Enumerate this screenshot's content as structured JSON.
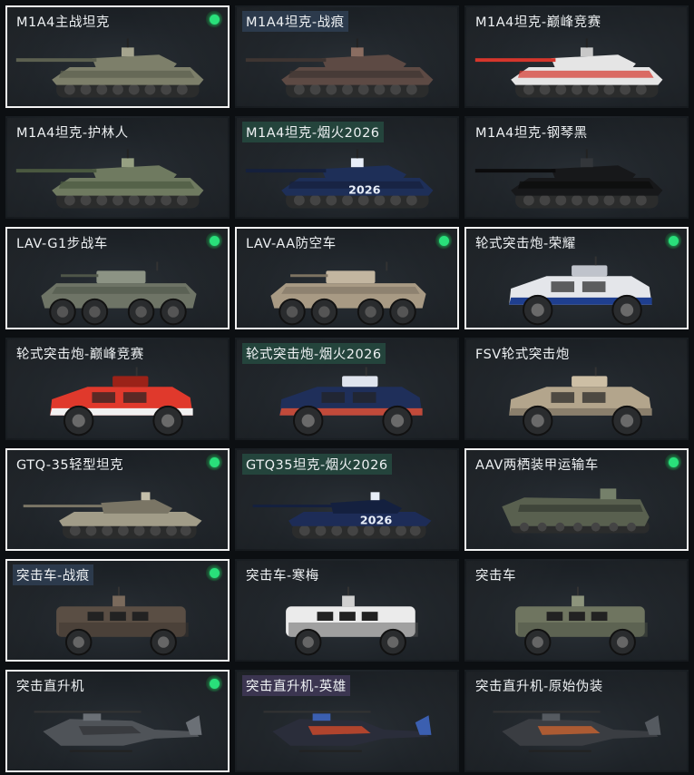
{
  "vehicles": [
    {
      "name": "M1A4主战坦克",
      "kind": "tank",
      "selected": true,
      "owned": true,
      "tag": "",
      "colors": {
        "body": "#7d7f6a",
        "accent": "#5c6050",
        "detail": "#a5a48e"
      }
    },
    {
      "name": "M1A4坦克-战痕",
      "kind": "tank",
      "selected": false,
      "owned": false,
      "tag": "blue",
      "colors": {
        "body": "#5d4a44",
        "accent": "#3e3532",
        "detail": "#8a6d61"
      }
    },
    {
      "name": "M1A4坦克-巅峰竞赛",
      "kind": "tank",
      "selected": false,
      "owned": false,
      "tag": "",
      "colors": {
        "body": "#e5e5e5",
        "accent": "#d6362c",
        "detail": "#c8c8c8"
      }
    },
    {
      "name": "M1A4坦克-护林人",
      "kind": "tank",
      "selected": false,
      "owned": false,
      "tag": "",
      "colors": {
        "body": "#6f7a60",
        "accent": "#4a5840",
        "detail": "#96a082"
      }
    },
    {
      "name": "M1A4坦克-烟火2026",
      "kind": "tank",
      "selected": false,
      "owned": false,
      "tag": "green",
      "colors": {
        "body": "#1e2f58",
        "accent": "#15203c",
        "detail": "#e8eef8"
      },
      "decal": "2026"
    },
    {
      "name": "M1A4坦克-钢琴黑",
      "kind": "tank",
      "selected": false,
      "owned": false,
      "tag": "",
      "colors": {
        "body": "#17181a",
        "accent": "#0b0b0c",
        "detail": "#33363a"
      }
    },
    {
      "name": "LAV-G1步战车",
      "kind": "ifv",
      "selected": true,
      "owned": true,
      "tag": "",
      "colors": {
        "body": "#6e7466",
        "accent": "#4f5649",
        "detail": "#8c9384"
      }
    },
    {
      "name": "LAV-AA防空车",
      "kind": "ifv",
      "selected": true,
      "owned": true,
      "tag": "",
      "colors": {
        "body": "#a89a84",
        "accent": "#7d7362",
        "detail": "#c3b6a0"
      }
    },
    {
      "name": "轮式突击炮-荣耀",
      "kind": "apc",
      "selected": true,
      "owned": true,
      "tag": "",
      "colors": {
        "body": "#e4e6ea",
        "accent": "#1f3f8f",
        "detail": "#bfc3cb"
      }
    },
    {
      "name": "轮式突击炮-巅峰竞赛",
      "kind": "apc",
      "selected": false,
      "owned": false,
      "tag": "",
      "colors": {
        "body": "#e0392c",
        "accent": "#f1f1f1",
        "detail": "#9b2218"
      }
    },
    {
      "name": "轮式突击炮-烟火2026",
      "kind": "apc",
      "selected": false,
      "owned": false,
      "tag": "green",
      "colors": {
        "body": "#1f2f5a",
        "accent": "#c04a3a",
        "detail": "#dfe4ee"
      }
    },
    {
      "name": "FSV轮式突击炮",
      "kind": "apc",
      "selected": false,
      "owned": false,
      "tag": "",
      "colors": {
        "body": "#b3a58c",
        "accent": "#8a7f6c",
        "detail": "#cdbfa5"
      }
    },
    {
      "name": "GTQ-35轻型坦克",
      "kind": "lighttank",
      "selected": true,
      "owned": true,
      "tag": "",
      "colors": {
        "body": "#a19c88",
        "accent": "#7a7565",
        "detail": "#c4bfaa"
      }
    },
    {
      "name": "GTQ35坦克-烟火2026",
      "kind": "lighttank",
      "selected": false,
      "owned": false,
      "tag": "green",
      "colors": {
        "body": "#1d2c57",
        "accent": "#14203f",
        "detail": "#e8eef8"
      },
      "decal": "2026"
    },
    {
      "name": "AAV两栖装甲运输车",
      "kind": "amphib",
      "selected": true,
      "owned": true,
      "tag": "",
      "colors": {
        "body": "#59604f",
        "accent": "#3f453a",
        "detail": "#75806a"
      }
    },
    {
      "name": "突击车-战痕",
      "kind": "truck",
      "selected": true,
      "owned": true,
      "tag": "blue",
      "colors": {
        "body": "#5a4e44",
        "accent": "#3b332d",
        "detail": "#7a6a5c"
      }
    },
    {
      "name": "突击车-寒梅",
      "kind": "truck",
      "selected": false,
      "owned": false,
      "tag": "",
      "colors": {
        "body": "#ebebeb",
        "accent": "#555",
        "detail": "#cfcfcf"
      }
    },
    {
      "name": "突击车",
      "kind": "truck",
      "selected": false,
      "owned": false,
      "tag": "",
      "colors": {
        "body": "#6f7560",
        "accent": "#4c5243",
        "detail": "#8d947c"
      }
    },
    {
      "name": "突击直升机",
      "kind": "heli",
      "selected": true,
      "owned": true,
      "tag": "",
      "colors": {
        "body": "#4f5358",
        "accent": "#33363a",
        "detail": "#6b7076"
      }
    },
    {
      "name": "突击直升机-英雄",
      "kind": "heli",
      "selected": false,
      "owned": false,
      "tag": "purple",
      "colors": {
        "body": "#2a2d3a",
        "accent": "#d24a2a",
        "detail": "#3b5fb0"
      }
    },
    {
      "name": "突击直升机-原始伪装",
      "kind": "heli",
      "selected": false,
      "owned": false,
      "tag": "",
      "colors": {
        "body": "#3a3d42",
        "accent": "#c9632f",
        "detail": "#555a60"
      }
    }
  ]
}
